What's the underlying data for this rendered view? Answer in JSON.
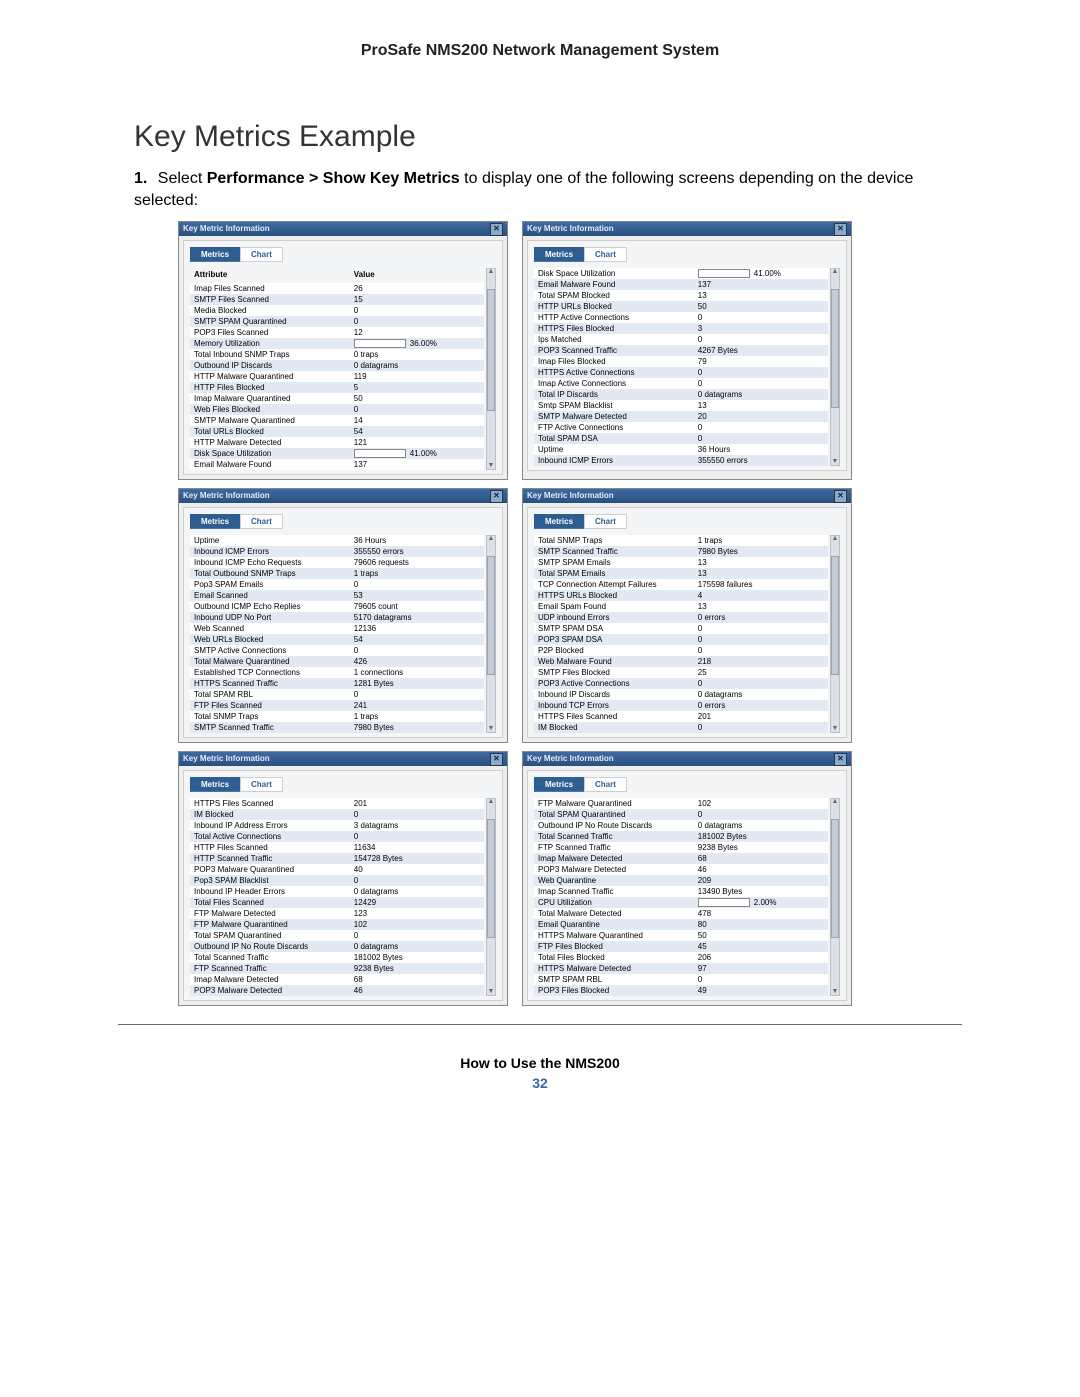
{
  "doc": {
    "header": "ProSafe NMS200 Network Management System",
    "section_title": "Key Metrics Example",
    "step_num": "1.",
    "step_text_prefix": "Select ",
    "step_text_bold": "Performance > Show Key Metrics",
    "step_text_suffix": " to display one of the following screens depending on the device selected:",
    "footer_title": "How to Use the NMS200",
    "footer_page": "32"
  },
  "win_title": "Key Metric Information",
  "close_glyph": "✕",
  "tab_metrics": "Metrics",
  "tab_chart": "Chart",
  "th_attr": "Attribute",
  "th_val": "Value",
  "panels": [
    {
      "has_headers": true,
      "rows": [
        {
          "a": "Imap Files Scanned",
          "v": "26"
        },
        {
          "a": "SMTP Files Scanned",
          "v": "15"
        },
        {
          "a": "Media Blocked",
          "v": "0"
        },
        {
          "a": "SMTP SPAM Quarantined",
          "v": "0"
        },
        {
          "a": "POP3 Files Scanned",
          "v": "12"
        },
        {
          "a": "Memory Utilization",
          "v": "36.00%",
          "bar": 36
        },
        {
          "a": "Total Inbound SNMP Traps",
          "v": "0 traps"
        },
        {
          "a": "Outbound IP Discards",
          "v": "0 datagrams"
        },
        {
          "a": "HTTP Malware Quarantined",
          "v": "119"
        },
        {
          "a": "HTTP Files Blocked",
          "v": "5"
        },
        {
          "a": "Imap Malware Quarantined",
          "v": "50"
        },
        {
          "a": "Web Files Blocked",
          "v": "0"
        },
        {
          "a": "SMTP Malware Quarantined",
          "v": "14"
        },
        {
          "a": "Total URLs Blocked",
          "v": "54"
        },
        {
          "a": "HTTP Malware Detected",
          "v": "121"
        },
        {
          "a": "Disk Space Utilization",
          "v": "41.00%",
          "bar": 41
        },
        {
          "a": "Email Malware Found",
          "v": "137"
        }
      ]
    },
    {
      "has_headers": false,
      "rows": [
        {
          "a": "Disk Space Utilization",
          "v": "41.00%",
          "bar": 41
        },
        {
          "a": "Email Malware Found",
          "v": "137"
        },
        {
          "a": "Total SPAM Blocked",
          "v": "13"
        },
        {
          "a": "HTTP URLs Blocked",
          "v": "50"
        },
        {
          "a": "HTTP Active Connections",
          "v": "0"
        },
        {
          "a": "HTTPS Files Blocked",
          "v": "3"
        },
        {
          "a": "Ips Matched",
          "v": "0"
        },
        {
          "a": "POP3 Scanned Traffic",
          "v": "4267 Bytes"
        },
        {
          "a": "Imap Files Blocked",
          "v": "79"
        },
        {
          "a": "HTTPS Active Connections",
          "v": "0"
        },
        {
          "a": "Imap Active Connections",
          "v": "0"
        },
        {
          "a": "Total IP Discards",
          "v": "0 datagrams"
        },
        {
          "a": "Smtp SPAM Blacklist",
          "v": "13"
        },
        {
          "a": "SMTP Malware Detected",
          "v": "20"
        },
        {
          "a": "FTP Active Connections",
          "v": "0"
        },
        {
          "a": "Total SPAM DSA",
          "v": "0"
        },
        {
          "a": "Uptime",
          "v": "36 Hours"
        },
        {
          "a": "Inbound ICMP Errors",
          "v": "355550 errors"
        }
      ]
    },
    {
      "has_headers": false,
      "rows": [
        {
          "a": "Uptime",
          "v": "36 Hours"
        },
        {
          "a": "Inbound ICMP Errors",
          "v": "355550 errors"
        },
        {
          "a": "Inbound ICMP Echo Requests",
          "v": "79606 requests"
        },
        {
          "a": "Total Outbound SNMP Traps",
          "v": "1 traps"
        },
        {
          "a": "Pop3 SPAM Emails",
          "v": "0"
        },
        {
          "a": "Email Scanned",
          "v": "53"
        },
        {
          "a": "Outbound ICMP Echo Replies",
          "v": "79605 count"
        },
        {
          "a": "Inbound UDP No Port",
          "v": "5170 datagrams"
        },
        {
          "a": "Web Scanned",
          "v": "12136"
        },
        {
          "a": "Web URLs Blocked",
          "v": "54"
        },
        {
          "a": "SMTP Active Connections",
          "v": "0"
        },
        {
          "a": "Total Malware Quarantined",
          "v": "426"
        },
        {
          "a": "Established TCP Connections",
          "v": "1 connections"
        },
        {
          "a": "HTTPS Scanned Traffic",
          "v": "1281 Bytes"
        },
        {
          "a": "Total SPAM RBL",
          "v": "0"
        },
        {
          "a": "FTP Files Scanned",
          "v": "241"
        },
        {
          "a": "Total SNMP Traps",
          "v": "1 traps"
        },
        {
          "a": "SMTP Scanned Traffic",
          "v": "7980 Bytes"
        }
      ]
    },
    {
      "has_headers": false,
      "rows": [
        {
          "a": "Total SNMP Traps",
          "v": "1 traps"
        },
        {
          "a": "SMTP Scanned Traffic",
          "v": "7980 Bytes"
        },
        {
          "a": "SMTP SPAM Emails",
          "v": "13"
        },
        {
          "a": "Total SPAM Emails",
          "v": "13"
        },
        {
          "a": "TCP Connection Attempt Failures",
          "v": "175598 failures"
        },
        {
          "a": "HTTPS URLs Blocked",
          "v": "4"
        },
        {
          "a": "Email Spam Found",
          "v": "13"
        },
        {
          "a": "UDP inbound Errors",
          "v": "0 errors"
        },
        {
          "a": "SMTP SPAM DSA",
          "v": "0"
        },
        {
          "a": "POP3 SPAM DSA",
          "v": "0"
        },
        {
          "a": "P2P Blocked",
          "v": "0"
        },
        {
          "a": "Web Malware Found",
          "v": "218"
        },
        {
          "a": "SMTP Files Blocked",
          "v": "25"
        },
        {
          "a": "POP3 Active Connections",
          "v": "0"
        },
        {
          "a": "Inbound IP Discards",
          "v": "0 datagrams"
        },
        {
          "a": "Inbound TCP Errors",
          "v": "0 errors"
        },
        {
          "a": "HTTPS Files Scanned",
          "v": "201"
        },
        {
          "a": "IM Blocked",
          "v": "0"
        }
      ]
    },
    {
      "has_headers": false,
      "rows": [
        {
          "a": "HTTPS Files Scanned",
          "v": "201"
        },
        {
          "a": "IM Blocked",
          "v": "0"
        },
        {
          "a": "Inbound IP Address Errors",
          "v": "3 datagrams"
        },
        {
          "a": "Total Active Connections",
          "v": "0"
        },
        {
          "a": "HTTP Files Scanned",
          "v": "11634"
        },
        {
          "a": "HTTP Scanned Traffic",
          "v": "154728 Bytes"
        },
        {
          "a": "POP3 Malware Quarantined",
          "v": "40"
        },
        {
          "a": "Pop3 SPAM Blacklist",
          "v": "0"
        },
        {
          "a": "Inbound IP Header Errors",
          "v": "0 datagrams"
        },
        {
          "a": "Total Files Scanned",
          "v": "12429"
        },
        {
          "a": "FTP Malware Detected",
          "v": "123"
        },
        {
          "a": "FTP Malware Quarantined",
          "v": "102"
        },
        {
          "a": "Total SPAM Quarantined",
          "v": "0"
        },
        {
          "a": "Outbound IP No Route Discards",
          "v": "0 datagrams"
        },
        {
          "a": "Total Scanned Traffic",
          "v": "181002 Bytes"
        },
        {
          "a": "FTP Scanned Traffic",
          "v": "9238 Bytes"
        },
        {
          "a": "Imap Malware Detected",
          "v": "68"
        },
        {
          "a": "POP3 Malware Detected",
          "v": "46"
        }
      ]
    },
    {
      "has_headers": false,
      "rows": [
        {
          "a": "FTP Malware Quarantined",
          "v": "102"
        },
        {
          "a": "Total SPAM Quarantined",
          "v": "0"
        },
        {
          "a": "Outbound IP No Route Discards",
          "v": "0 datagrams"
        },
        {
          "a": "Total Scanned Traffic",
          "v": "181002 Bytes"
        },
        {
          "a": "FTP Scanned Traffic",
          "v": "9238 Bytes"
        },
        {
          "a": "Imap Malware Detected",
          "v": "68"
        },
        {
          "a": "POP3 Malware Detected",
          "v": "46"
        },
        {
          "a": "Web Quarantine",
          "v": "209"
        },
        {
          "a": "Imap Scanned Traffic",
          "v": "13490 Bytes"
        },
        {
          "a": "CPU Utilization",
          "v": "2.00%",
          "bar": 2
        },
        {
          "a": "Total Malware Detected",
          "v": "478"
        },
        {
          "a": "Email Quarantine",
          "v": "80"
        },
        {
          "a": "HTTPS Malware Quarantined",
          "v": "50"
        },
        {
          "a": "FTP Files Blocked",
          "v": "45"
        },
        {
          "a": "Total Files Blocked",
          "v": "206"
        },
        {
          "a": "HTTPS Malware Detected",
          "v": "97"
        },
        {
          "a": "SMTP SPAM RBL",
          "v": "0"
        },
        {
          "a": "POP3 Files Blocked",
          "v": "49"
        }
      ]
    }
  ]
}
